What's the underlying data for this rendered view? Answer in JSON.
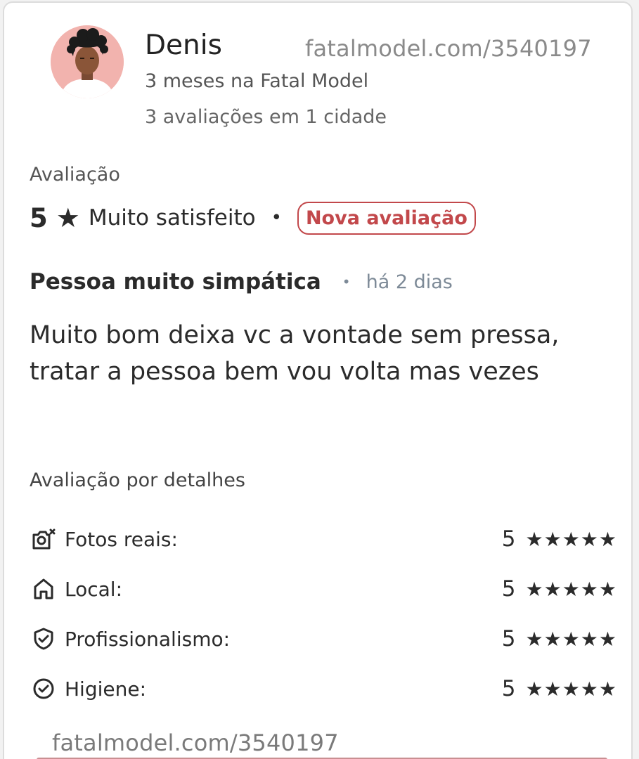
{
  "user": {
    "name": "Denis",
    "member_since": "3 meses na Fatal Model",
    "review_count": "3 avaliações em 1 cidade"
  },
  "watermarks": {
    "top": "fatalmodel.com/3540197",
    "bottom": "fatalmodel.com/3540197"
  },
  "rating": {
    "label": "Avaliação",
    "score": "5",
    "star_icon": "★",
    "text": "Muito satisfeito",
    "separator": "•",
    "badge": "Nova avaliação"
  },
  "review": {
    "title": "Pessoa muito simpática",
    "separator": "•",
    "date": "há 2 dias",
    "body": "Muito bom deixa vc a vontade sem pressa, tratar a pessoa bem vou volta mas vezes"
  },
  "details": {
    "heading": "Avaliação por detalhes",
    "items": [
      {
        "icon": "camera-icon",
        "label": "Fotos reais:",
        "score": "5",
        "stars": "★★★★★"
      },
      {
        "icon": "home-icon",
        "label": "Local:",
        "score": "5",
        "stars": "★★★★★"
      },
      {
        "icon": "shield-check-icon",
        "label": "Profissionalismo:",
        "score": "5",
        "stars": "★★★★★"
      },
      {
        "icon": "check-circle-icon",
        "label": "Higiene:",
        "score": "5",
        "stars": "★★★★★"
      }
    ]
  },
  "colors": {
    "accent": "#c2484b",
    "muted": "#7d8a97",
    "avatar_bg": "#f2b3ae"
  }
}
